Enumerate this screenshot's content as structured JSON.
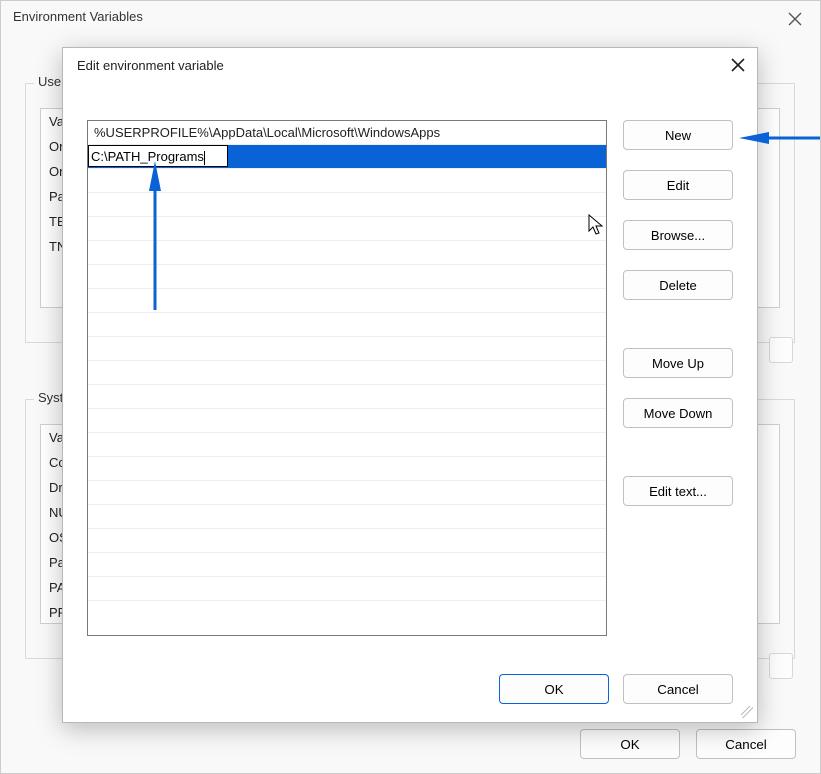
{
  "parent": {
    "title": "Environment Variables",
    "user_group_label": "User",
    "sys_group_label": "Syste",
    "user_rows": [
      "Va",
      "On",
      "On",
      "Pa",
      "TE",
      "TN"
    ],
    "sys_rows": [
      "Va",
      "Co",
      "Dr",
      "NU",
      "OS",
      "Pa",
      "PA",
      "PR"
    ],
    "ok": "OK",
    "cancel": "Cancel"
  },
  "modal": {
    "title": "Edit environment variable",
    "rows": [
      "%USERPROFILE%\\AppData\\Local\\Microsoft\\WindowsApps"
    ],
    "editing_value": "C:\\PATH_Programs",
    "buttons": {
      "new": "New",
      "edit": "Edit",
      "browse": "Browse...",
      "delete": "Delete",
      "move_up": "Move Up",
      "move_down": "Move Down",
      "edit_text": "Edit text..."
    },
    "ok": "OK",
    "cancel": "Cancel"
  }
}
